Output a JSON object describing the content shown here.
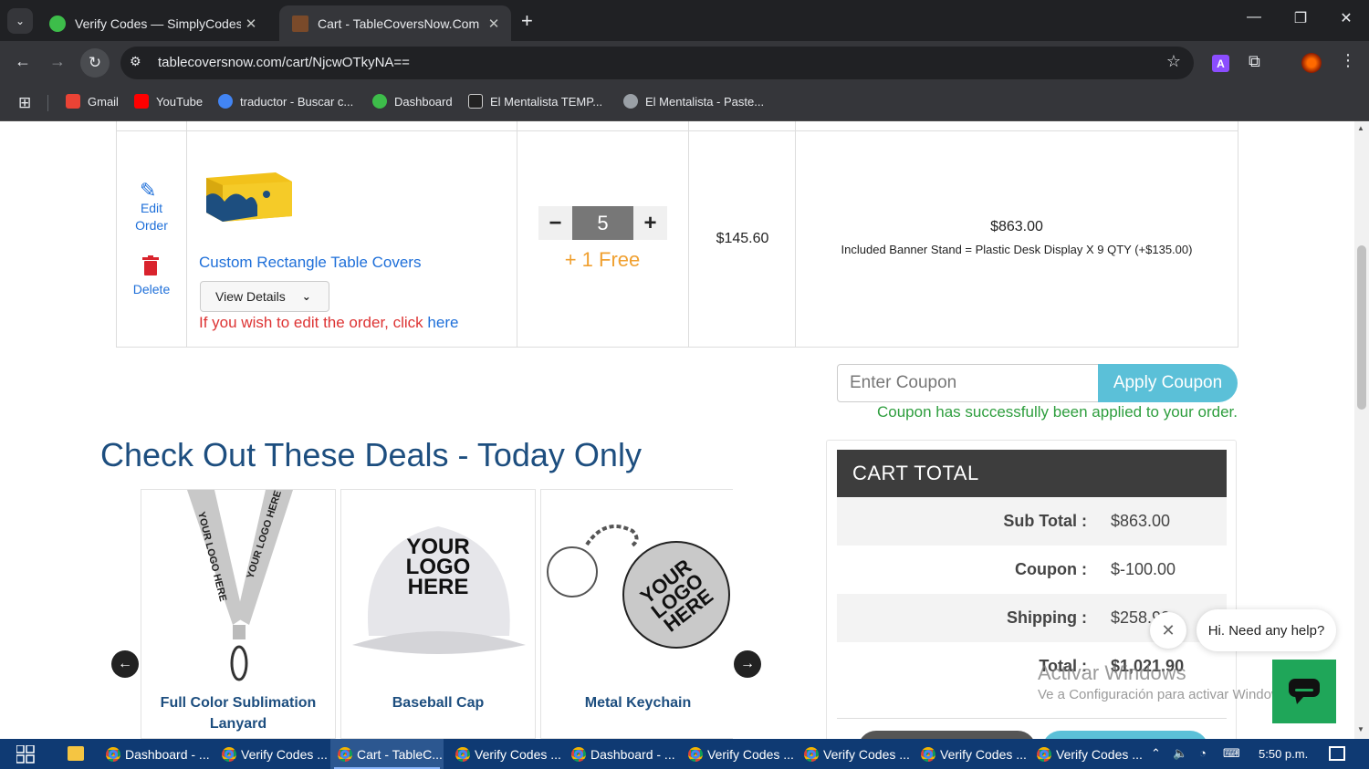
{
  "browser": {
    "tabs": [
      {
        "title": "Verify Codes — SimplyCodes",
        "favicon_color": "#3dbd4a",
        "active": false
      },
      {
        "title": "Cart - TableCoversNow.Com",
        "favicon_color": "#7a4a2a",
        "active": true
      }
    ],
    "url": "tablecoversnow.com/cart/NjcwOTkyNA==",
    "bookmarks": [
      {
        "label": "Gmail",
        "color": "#ea4335"
      },
      {
        "label": "YouTube",
        "color": "#ff0000"
      },
      {
        "label": "traductor - Buscar c...",
        "color": "#4285f4"
      },
      {
        "label": "Dashboard",
        "color": "#3dbd4a"
      },
      {
        "label": "El Mentalista TEMP...",
        "color": "#222222"
      },
      {
        "label": "El Mentalista - Paste...",
        "color": "#9aa0a6"
      }
    ]
  },
  "cart": {
    "edit_label": "Edit Order",
    "delete_label": "Delete",
    "product_name": "Custom Rectangle Table Covers",
    "view_details": "View Details",
    "edit_msg": "If you wish to edit the order, click",
    "edit_link": "here",
    "quantity": "5",
    "free": "+ 1 Free",
    "unit_price": "$145.60",
    "line_total": "$863.00",
    "line_note": "Included Banner Stand = Plastic Desk Display X 9 QTY (+$135.00)"
  },
  "coupon": {
    "placeholder": "Enter Coupon",
    "apply": "Apply Coupon",
    "success": "Coupon has successfully been applied to your order."
  },
  "deals": {
    "title": "Check Out These Deals - Today Only",
    "items": [
      {
        "name": "Full Color Sublimation Lanyard"
      },
      {
        "name": "Baseball Cap"
      },
      {
        "name": "Metal Keychain"
      }
    ]
  },
  "cart_total": {
    "title": "CART  TOTAL",
    "rows": [
      {
        "label": "Sub Total :",
        "value": "$863.00"
      },
      {
        "label": "Coupon :",
        "value": "$-100.00"
      },
      {
        "label": "Shipping :",
        "value": "$258.90"
      },
      {
        "label": "Total :",
        "value": "$1,021.90"
      }
    ]
  },
  "watermark": {
    "line1": "Activar Windows",
    "line2": "Ve a Configuración para activar Windows."
  },
  "chat": {
    "greeting": "Hi. Need any help?"
  },
  "taskbar": {
    "items": [
      {
        "label": "Dashboard - ..."
      },
      {
        "label": "Verify Codes ..."
      },
      {
        "label": "Cart - TableC..."
      },
      {
        "label": "Verify Codes ..."
      },
      {
        "label": "Dashboard - ..."
      },
      {
        "label": "Verify Codes ..."
      },
      {
        "label": "Verify Codes ..."
      },
      {
        "label": "Verify Codes ..."
      },
      {
        "label": "Verify Codes ..."
      }
    ],
    "time": "5:50 p.m."
  }
}
